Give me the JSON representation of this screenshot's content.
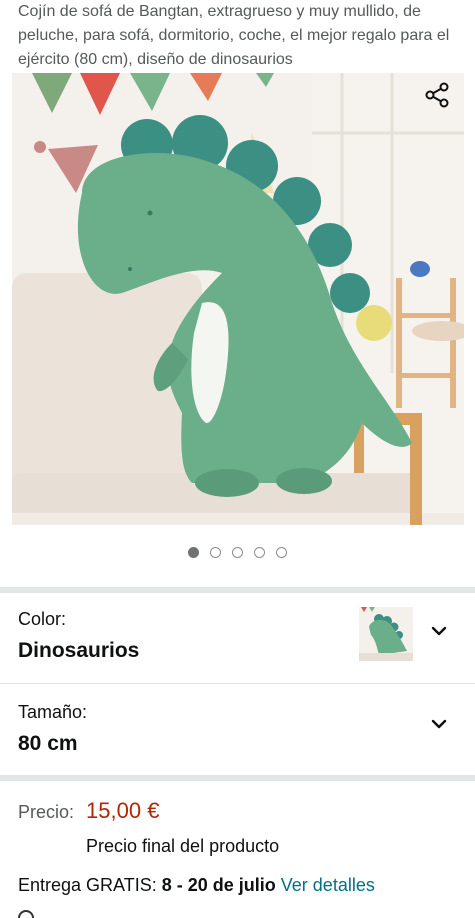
{
  "product": {
    "title": "Cojín de sofá de Bangtan, extragrueso y muy mullido, de peluche, para sofá, dormitorio, coche, el mejor regalo para el ejército (80 cm), diseño de dinosaurios",
    "image_count": 5,
    "active_image_index": 0
  },
  "variations": {
    "color": {
      "label": "Color:",
      "value": "Dinosaurios"
    },
    "size": {
      "label": "Tamaño:",
      "value": "80 cm"
    }
  },
  "price": {
    "label": "Precio:",
    "value": "15,00 €",
    "note": "Precio final del producto"
  },
  "delivery": {
    "prefix": "Entrega GRATIS:",
    "dates": "8 - 20 de julio",
    "link": "Ver detalles"
  },
  "colors": {
    "price": "#b12704",
    "link": "#007185",
    "dino_green": "#6aae8a",
    "spikes": "#3b8f83"
  },
  "icons": {
    "share": "share-icon",
    "chevron": "chevron-down-icon"
  }
}
